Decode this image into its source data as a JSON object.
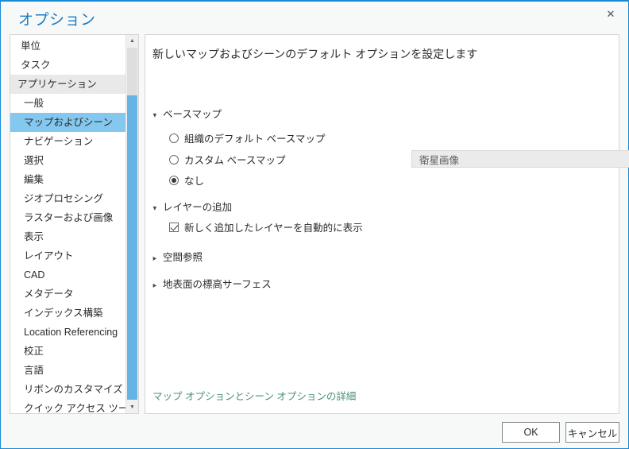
{
  "window": {
    "title": "オプション",
    "close_icon": "close-icon"
  },
  "sidebar": {
    "items": [
      {
        "label": "単位",
        "type": "item"
      },
      {
        "label": "タスク",
        "type": "item"
      },
      {
        "label": "アプリケーション",
        "type": "group"
      },
      {
        "label": "一般",
        "type": "child"
      },
      {
        "label": "マップおよびシーン",
        "type": "selected"
      },
      {
        "label": "ナビゲーション",
        "type": "child"
      },
      {
        "label": "選択",
        "type": "child"
      },
      {
        "label": "編集",
        "type": "child"
      },
      {
        "label": "ジオプロセシング",
        "type": "child"
      },
      {
        "label": "ラスターおよび画像",
        "type": "child"
      },
      {
        "label": "表示",
        "type": "child"
      },
      {
        "label": "レイアウト",
        "type": "child"
      },
      {
        "label": "CAD",
        "type": "child"
      },
      {
        "label": "メタデータ",
        "type": "child"
      },
      {
        "label": "インデックス構築",
        "type": "child"
      },
      {
        "label": "Location Referencing",
        "type": "child"
      },
      {
        "label": "校正",
        "type": "child"
      },
      {
        "label": "言語",
        "type": "child"
      },
      {
        "label": "リボンのカスタマイズ",
        "type": "child"
      },
      {
        "label": "クイック アクセス ツールバー",
        "type": "child"
      }
    ]
  },
  "content": {
    "header": "新しいマップおよびシーンのデフォルト オプションを設定します",
    "sections": {
      "basemap": {
        "label": "ベースマップ",
        "expanded_icon": "chevron-down-icon",
        "options": [
          {
            "label": "組織のデフォルト ベースマップ",
            "selected": false
          },
          {
            "label": "カスタム ベースマップ",
            "selected": false
          },
          {
            "label": "なし",
            "selected": true
          }
        ],
        "combo": {
          "value": "衛星画像",
          "arrow_icon": "chevron-down-icon",
          "disabled": true
        }
      },
      "add_layer": {
        "label": "レイヤーの追加",
        "expanded_icon": "chevron-down-icon",
        "checkbox": {
          "label": "新しく追加したレイヤーを自動的に表示",
          "checked": true
        }
      },
      "spatial_reference": {
        "label": "空間参照",
        "collapsed_icon": "chevron-right-icon"
      },
      "ground_elevation": {
        "label": "地表面の標高サーフェス",
        "collapsed_icon": "chevron-right-icon"
      }
    },
    "help_link": "マップ オプションとシーン オプションの詳細"
  },
  "footer": {
    "ok_label": "OK",
    "cancel_label": "キャンセル"
  },
  "colors": {
    "accent_blue": "#1a8ad4",
    "title_blue": "#1a7dc4",
    "selection_blue": "#84c8ef",
    "group_gray": "#e9e9e9",
    "link_green": "#4c8f7a"
  }
}
